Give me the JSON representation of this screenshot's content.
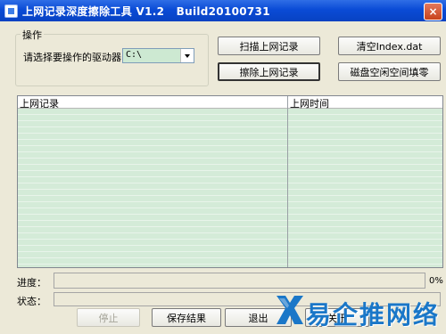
{
  "window": {
    "title": "上网记录深度擦除工具 V1.2   Build20100731",
    "close_label": "×"
  },
  "ops": {
    "group_label": "操作",
    "drive_label": "请选择要操作的驱动器：",
    "drive_value": "C:\\"
  },
  "buttons": {
    "scan": "扫描上网记录",
    "clear_index": "清空Index.dat",
    "remove": "擦除上网记录",
    "fill_disk": "磁盘空闲空间填零",
    "stop": "停止",
    "save": "保存结果",
    "exit": "退出",
    "about": "关于"
  },
  "table": {
    "columns": [
      "上网记录",
      "上网时间"
    ]
  },
  "progress": {
    "label": "进度：",
    "value": 0,
    "percent_text": "0%"
  },
  "status": {
    "label": "状态："
  },
  "watermark": {
    "text": "易企推网络"
  }
}
